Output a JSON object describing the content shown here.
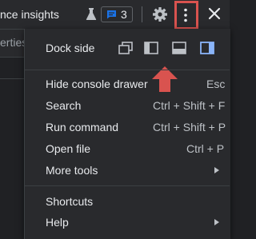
{
  "toolbar": {
    "tab_title": "nce insights",
    "issues_count": "3"
  },
  "background": {
    "tab_text": "erties"
  },
  "menu": {
    "dock_side_label": "Dock side",
    "items": [
      {
        "label": "Hide console drawer",
        "shortcut": "Esc"
      },
      {
        "label": "Search",
        "shortcut": "Ctrl + Shift + F"
      },
      {
        "label": "Run command",
        "shortcut": "Ctrl + Shift + P"
      },
      {
        "label": "Open file",
        "shortcut": "Ctrl + P"
      },
      {
        "label": "More tools",
        "shortcut": ""
      }
    ],
    "bottom_items": [
      {
        "label": "Shortcuts"
      },
      {
        "label": "Help"
      }
    ]
  },
  "colors": {
    "background": "#202124",
    "menu": "#292a2d",
    "text": "#e8eaed",
    "accent": "#8ab4f8",
    "badge": "#1a73e8",
    "annotation": "#d9534f"
  }
}
